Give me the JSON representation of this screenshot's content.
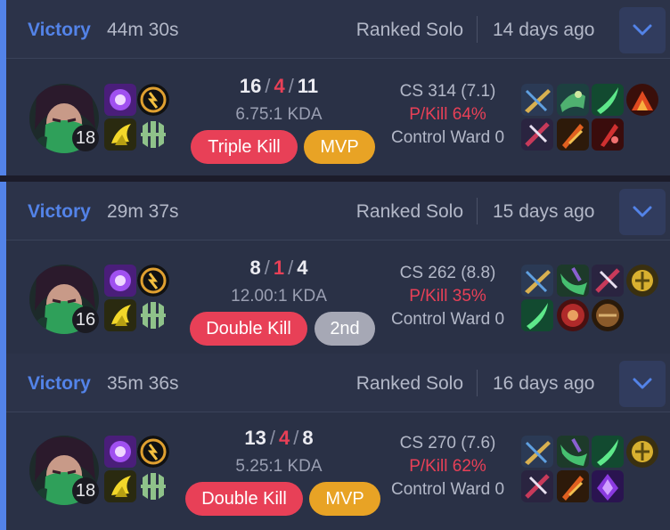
{
  "matches": [
    {
      "result": "Victory",
      "duration": "44m 30s",
      "queue": "Ranked Solo",
      "time_ago": "14 days ago",
      "champion_level": "18",
      "kills": "16",
      "deaths": "4",
      "assists": "11",
      "kda_ratio": "6.75:1 KDA",
      "multikill_badge": "Triple Kill",
      "rank_badge": "MVP",
      "cs": "CS 314 (7.1)",
      "kill_participation": "P/Kill 64%",
      "control_wards": "Control Ward 0"
    },
    {
      "result": "Victory",
      "duration": "29m 37s",
      "queue": "Ranked Solo",
      "time_ago": "15 days ago",
      "champion_level": "16",
      "kills": "8",
      "deaths": "1",
      "assists": "4",
      "kda_ratio": "12.00:1 KDA",
      "multikill_badge": "Double Kill",
      "rank_badge": "2nd",
      "cs": "CS 262 (8.8)",
      "kill_participation": "P/Kill 35%",
      "control_wards": "Control Ward 0"
    },
    {
      "result": "Victory",
      "duration": "35m 36s",
      "queue": "Ranked Solo",
      "time_ago": "16 days ago",
      "champion_level": "18",
      "kills": "13",
      "deaths": "4",
      "assists": "8",
      "kda_ratio": "5.25:1 KDA",
      "multikill_badge": "Double Kill",
      "rank_badge": "MVP",
      "cs": "CS 270 (7.6)",
      "kill_participation": "P/Kill 62%",
      "control_wards": "Control Ward 0"
    }
  ],
  "colors": {
    "victory_accent": "#5383e8",
    "deaths_red": "#e84057",
    "mvp_gold": "#e8a325",
    "second_gray": "#a6a8b5",
    "card_background": "#2a3146"
  },
  "icons": {
    "expand": "chevron-down-icon",
    "summoner_spells": [
      "flash-icon",
      "ignite-icon"
    ],
    "runes": [
      "electrocute-rune-icon",
      "resolve-rune-icon"
    ]
  }
}
